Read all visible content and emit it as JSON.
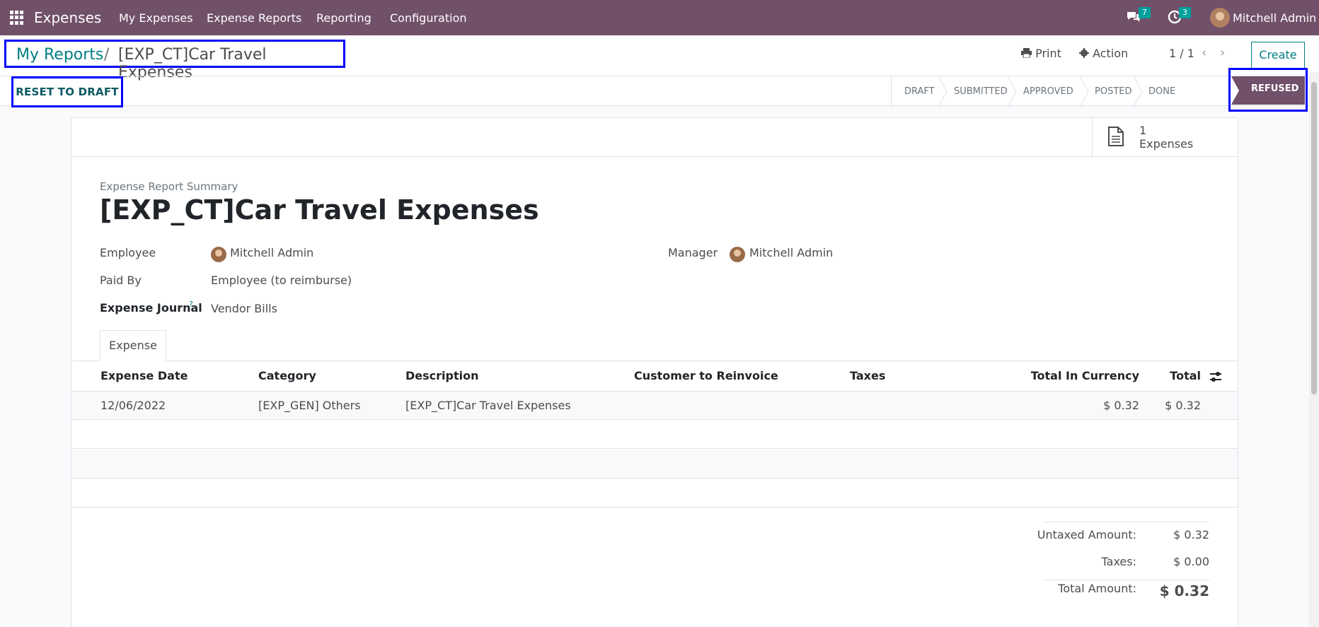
{
  "topnav": {
    "app_name": "Expenses",
    "menu": [
      "My Expenses",
      "Expense Reports",
      "Reporting",
      "Configuration"
    ],
    "messages_count": "7",
    "activities_count": "3",
    "user_name": "Mitchell Admin"
  },
  "breadcrumb": {
    "parent": "My Reports",
    "separator": "/",
    "current": "[EXP_CT]Car Travel Expenses"
  },
  "control": {
    "print_label": "Print",
    "action_label": "Action",
    "pager": "1 / 1",
    "create_label": "Create"
  },
  "buttons": {
    "reset_label": "RESET TO DRAFT"
  },
  "statusbar": {
    "stages": [
      "DRAFT",
      "SUBMITTED",
      "APPROVED",
      "POSTED",
      "DONE"
    ],
    "active": "REFUSED",
    "active_color": "#71506a"
  },
  "smart_button": {
    "count": "1",
    "label": "Expenses"
  },
  "form": {
    "subtitle": "Expense Report Summary",
    "title": "[EXP_CT]Car Travel Expenses",
    "employee_label": "Employee",
    "employee_value": "Mitchell Admin",
    "paid_by_label": "Paid By",
    "paid_by_value": "Employee (to reimburse)",
    "journal_label": "Expense Journal",
    "journal_help": "?",
    "journal_value": "Vendor Bills",
    "manager_label": "Manager",
    "manager_value": "Mitchell Admin"
  },
  "tabs": {
    "expense": "Expense"
  },
  "table": {
    "headers": [
      "Expense Date",
      "Category",
      "Description",
      "Customer to Reinvoice",
      "Taxes",
      "Total In Currency",
      "Total"
    ],
    "rows": [
      {
        "date": "12/06/2022",
        "category": "[EXP_GEN] Others",
        "description": "[EXP_CT]Car Travel Expenses",
        "customer": "",
        "taxes": "",
        "total_currency": "$ 0.32",
        "total": "$ 0.32"
      }
    ]
  },
  "totals": {
    "untaxed_label": "Untaxed Amount:",
    "untaxed_value": "$ 0.32",
    "taxes_label": "Taxes:",
    "taxes_value": "$ 0.00",
    "total_label": "Total Amount:",
    "total_value": "$ 0.32"
  },
  "colors": {
    "brand": "#71506a",
    "link": "#017e84",
    "highlight_box": "#0000ff"
  }
}
